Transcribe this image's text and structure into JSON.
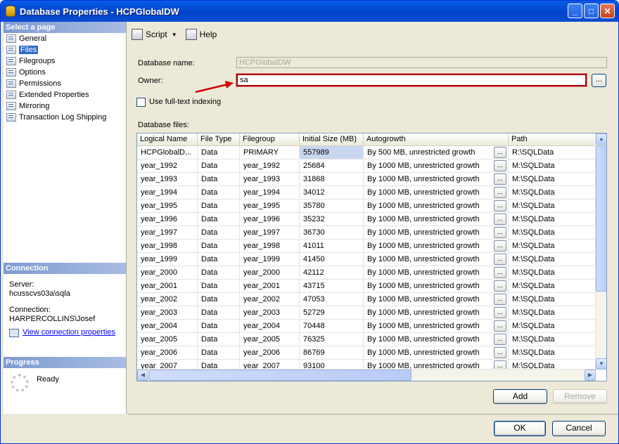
{
  "window": {
    "title": "Database Properties - HCPGlobalDW",
    "minimize": "_",
    "maximize": "□",
    "close": "✕"
  },
  "left_panel": {
    "select_header": "Select a page",
    "pages": [
      {
        "label": "General",
        "selected": false
      },
      {
        "label": "Files",
        "selected": true
      },
      {
        "label": "Filegroups",
        "selected": false
      },
      {
        "label": "Options",
        "selected": false
      },
      {
        "label": "Permissions",
        "selected": false
      },
      {
        "label": "Extended Properties",
        "selected": false
      },
      {
        "label": "Mirroring",
        "selected": false
      },
      {
        "label": "Transaction Log Shipping",
        "selected": false
      }
    ],
    "connection_header": "Connection",
    "server_label": "Server:",
    "server_value": "hcusscvs03a\\sqla",
    "connection_label": "Connection:",
    "connection_value": "HARPERCOLLINS\\Josef",
    "view_connection": "View connection properties",
    "progress_header": "Progress",
    "progress_status": "Ready"
  },
  "toolbar": {
    "script": "Script",
    "help": "Help"
  },
  "form": {
    "db_name_label": "Database name:",
    "db_name_value": "HCPGlobalDW",
    "owner_label": "Owner:",
    "owner_value": "sa",
    "browse": "...",
    "fulltext_label": "Use full-text indexing",
    "files_label": "Database files:"
  },
  "grid": {
    "columns": [
      "Logical Name",
      "File Type",
      "Filegroup",
      "Initial Size (MB)",
      "Autogrowth",
      "Path"
    ],
    "rows": [
      [
        "HCPGlobalD...",
        "Data",
        "PRIMARY",
        "557989",
        "By 500 MB, unrestricted growth",
        "R:\\SQLData"
      ],
      [
        "year_1992",
        "Data",
        "year_1992",
        "25684",
        "By 1000 MB, unrestricted growth",
        "M:\\SQLData"
      ],
      [
        "year_1993",
        "Data",
        "year_1993",
        "31868",
        "By 1000 MB, unrestricted growth",
        "M:\\SQLData"
      ],
      [
        "year_1994",
        "Data",
        "year_1994",
        "34012",
        "By 1000 MB, unrestricted growth",
        "M:\\SQLData"
      ],
      [
        "year_1995",
        "Data",
        "year_1995",
        "35780",
        "By 1000 MB, unrestricted growth",
        "M:\\SQLData"
      ],
      [
        "year_1996",
        "Data",
        "year_1996",
        "35232",
        "By 1000 MB, unrestricted growth",
        "M:\\SQLData"
      ],
      [
        "year_1997",
        "Data",
        "year_1997",
        "36730",
        "By 1000 MB, unrestricted growth",
        "M:\\SQLData"
      ],
      [
        "year_1998",
        "Data",
        "year_1998",
        "41011",
        "By 1000 MB, unrestricted growth",
        "M:\\SQLData"
      ],
      [
        "year_1999",
        "Data",
        "year_1999",
        "41450",
        "By 1000 MB, unrestricted growth",
        "M:\\SQLData"
      ],
      [
        "year_2000",
        "Data",
        "year_2000",
        "42112",
        "By 1000 MB, unrestricted growth",
        "M:\\SQLData"
      ],
      [
        "year_2001",
        "Data",
        "year_2001",
        "43715",
        "By 1000 MB, unrestricted growth",
        "M:\\SQLData"
      ],
      [
        "year_2002",
        "Data",
        "year_2002",
        "47053",
        "By 1000 MB, unrestricted growth",
        "M:\\SQLData"
      ],
      [
        "year_2003",
        "Data",
        "year_2003",
        "52729",
        "By 1000 MB, unrestricted growth",
        "M:\\SQLData"
      ],
      [
        "year_2004",
        "Data",
        "year_2004",
        "70448",
        "By 1000 MB, unrestricted growth",
        "M:\\SQLData"
      ],
      [
        "year_2005",
        "Data",
        "year_2005",
        "76325",
        "By 1000 MB, unrestricted growth",
        "M:\\SQLData"
      ],
      [
        "year_2006",
        "Data",
        "year_2006",
        "86769",
        "By 1000 MB, unrestricted growth",
        "M:\\SQLData"
      ],
      [
        "year_2007",
        "Data",
        "year_2007",
        "93100",
        "By 1000 MB, unrestricted growth",
        "M:\\SQLData"
      ]
    ],
    "cell_button": "..."
  },
  "buttons": {
    "add": "Add",
    "remove": "Remove",
    "ok": "OK",
    "cancel": "Cancel"
  },
  "colors": {
    "titlebar": "#0553db",
    "selection": "#316ac5",
    "annotation": "#cc0000"
  }
}
